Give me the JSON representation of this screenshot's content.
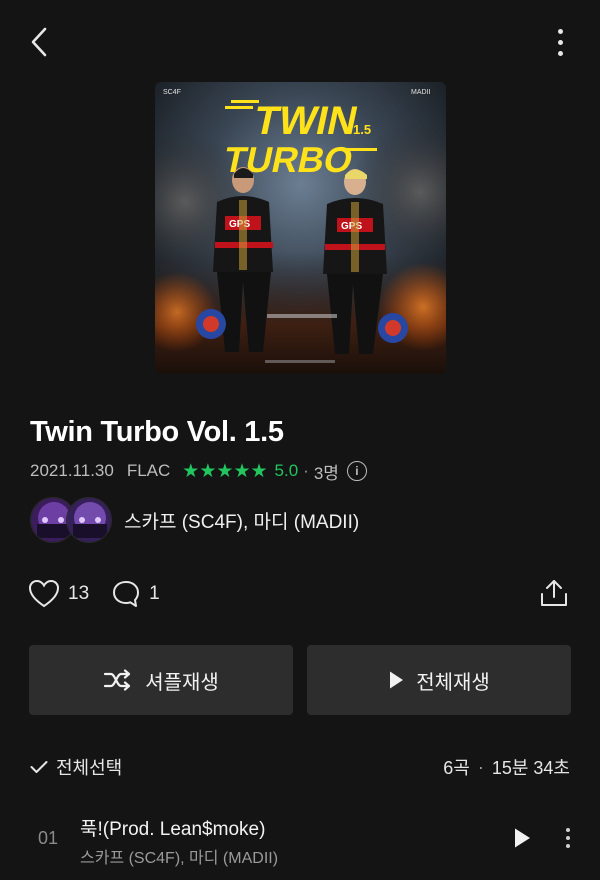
{
  "topbar": {
    "back_icon": "chevron-left-icon",
    "more_icon": "more-vertical-icon"
  },
  "album": {
    "cover_text": {
      "line1": "TWIN",
      "line2": "TURBO",
      "vol": "1.5",
      "left_tag": "SC4F",
      "right_tag": "MADII",
      "badge": "GPS"
    },
    "title": "Twin Turbo Vol. 1.5",
    "date": "2021.11.30",
    "format": "FLAC",
    "rating": "5.0",
    "rating_stars": 5,
    "rating_dot": "·",
    "rating_count": "3명",
    "artist": "스카프 (SC4F), 마디 (MADII)"
  },
  "social": {
    "likes": "13",
    "comments": "1"
  },
  "buttons": {
    "shuffle": "셔플재생",
    "play_all": "전체재생"
  },
  "list_header": {
    "select_all": "전체선택",
    "track_count": "6곡",
    "separator": "·",
    "duration": "15분 34초"
  },
  "tracks": [
    {
      "no": "01",
      "title": "푹!(Prod. Lean$moke)",
      "artist": "스카프 (SC4F), 마디 (MADII)"
    }
  ],
  "colors": {
    "background": "#141414",
    "accent_green": "#22c55e",
    "button_bg": "#2d2d2d"
  }
}
